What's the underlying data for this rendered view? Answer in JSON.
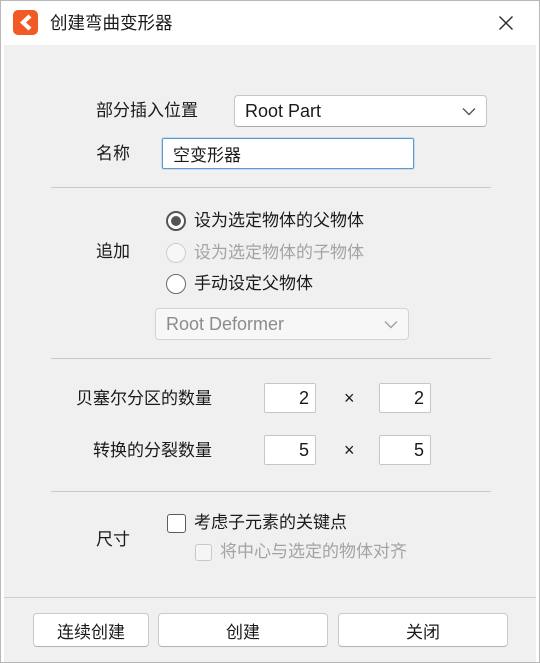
{
  "window": {
    "title": "创建弯曲变形器",
    "app_icon": "app-icon",
    "close_icon": "close-icon"
  },
  "colors": {
    "accent": "#f15a24",
    "focus_border": "#5b9bd5",
    "panel_bg": "#f0f0f0"
  },
  "insert_position": {
    "label": "部分插入位置",
    "value": "Root Part",
    "icon": "chevron-down-icon"
  },
  "name_field": {
    "label": "名称",
    "value": "空变形器"
  },
  "append": {
    "label": "追加",
    "options": [
      {
        "label": "设为选定物体的父物体",
        "checked": true,
        "disabled": false
      },
      {
        "label": "设为选定物体的子物体",
        "checked": false,
        "disabled": true
      },
      {
        "label": "手动设定父物体",
        "checked": false,
        "disabled": false
      }
    ],
    "parent_select": {
      "value": "Root Deformer",
      "disabled": true,
      "icon": "chevron-down-icon"
    }
  },
  "bezier_divisions": {
    "label": "贝塞尔分区的数量",
    "x": "2",
    "separator": "×",
    "y": "2"
  },
  "transform_divisions": {
    "label": "转换的分裂数量",
    "x": "5",
    "separator": "×",
    "y": "5"
  },
  "size": {
    "label": "尺寸",
    "options": [
      {
        "label": "考虑子元素的关键点",
        "checked": false,
        "disabled": false
      },
      {
        "label": "将中心与选定的物体对齐",
        "checked": false,
        "disabled": true
      }
    ]
  },
  "buttons": {
    "continuous_create": "连续创建",
    "create": "创建",
    "close": "关闭"
  }
}
